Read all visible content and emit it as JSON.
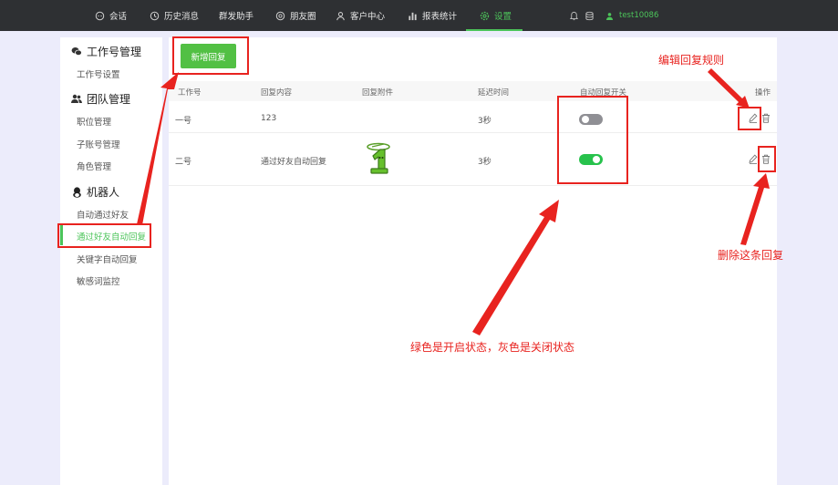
{
  "topnav": {
    "items": [
      {
        "label": "会话",
        "icon": "chat-icon"
      },
      {
        "label": "历史消息",
        "icon": "clock-icon"
      },
      {
        "label": "群发助手",
        "icon": ""
      },
      {
        "label": "朋友圈",
        "icon": "aperture-icon"
      },
      {
        "label": "客户中心",
        "icon": "user-icon"
      },
      {
        "label": "报表统计",
        "icon": "bar-chart-icon"
      },
      {
        "label": "设置",
        "icon": "gear-icon",
        "active": true
      }
    ],
    "username": "test10086",
    "accent_color": "#4cc45a"
  },
  "sidebar": {
    "groups": [
      {
        "title": "工作号管理",
        "icon": "wechat-icon",
        "items": [
          "工作号设置"
        ]
      },
      {
        "title": "团队管理",
        "icon": "team-icon",
        "items": [
          "职位管理",
          "子账号管理",
          "角色管理"
        ]
      },
      {
        "title": "机器人",
        "icon": "robot-icon",
        "items": [
          "自动通过好友",
          "通过好友自动回复",
          "关键字自动回复",
          "敏感词监控"
        ]
      }
    ],
    "active_item": "通过好友自动回复"
  },
  "main": {
    "add_button": "新增回复",
    "columns": [
      "工作号",
      "回复内容",
      "回复附件",
      "延迟时间",
      "自动回复开关",
      "操作"
    ],
    "rows": [
      {
        "account": "一号",
        "content": "123",
        "attachment": "",
        "delay": "3秒",
        "auto_reply_on": false
      },
      {
        "account": "二号",
        "content": "通过好友自动回复",
        "attachment": "number-one-image",
        "delay": "3秒",
        "auto_reply_on": true
      }
    ]
  },
  "annotations": {
    "edit": "编辑回复规则",
    "delete": "删除这条回复",
    "toggle": "绿色是开启状态，灰色是关闭状态"
  },
  "colors": {
    "annotation_red": "#e8231f",
    "toggle_on": "#27c24c",
    "toggle_off": "#8f8f94",
    "button_green": "#52c044"
  }
}
